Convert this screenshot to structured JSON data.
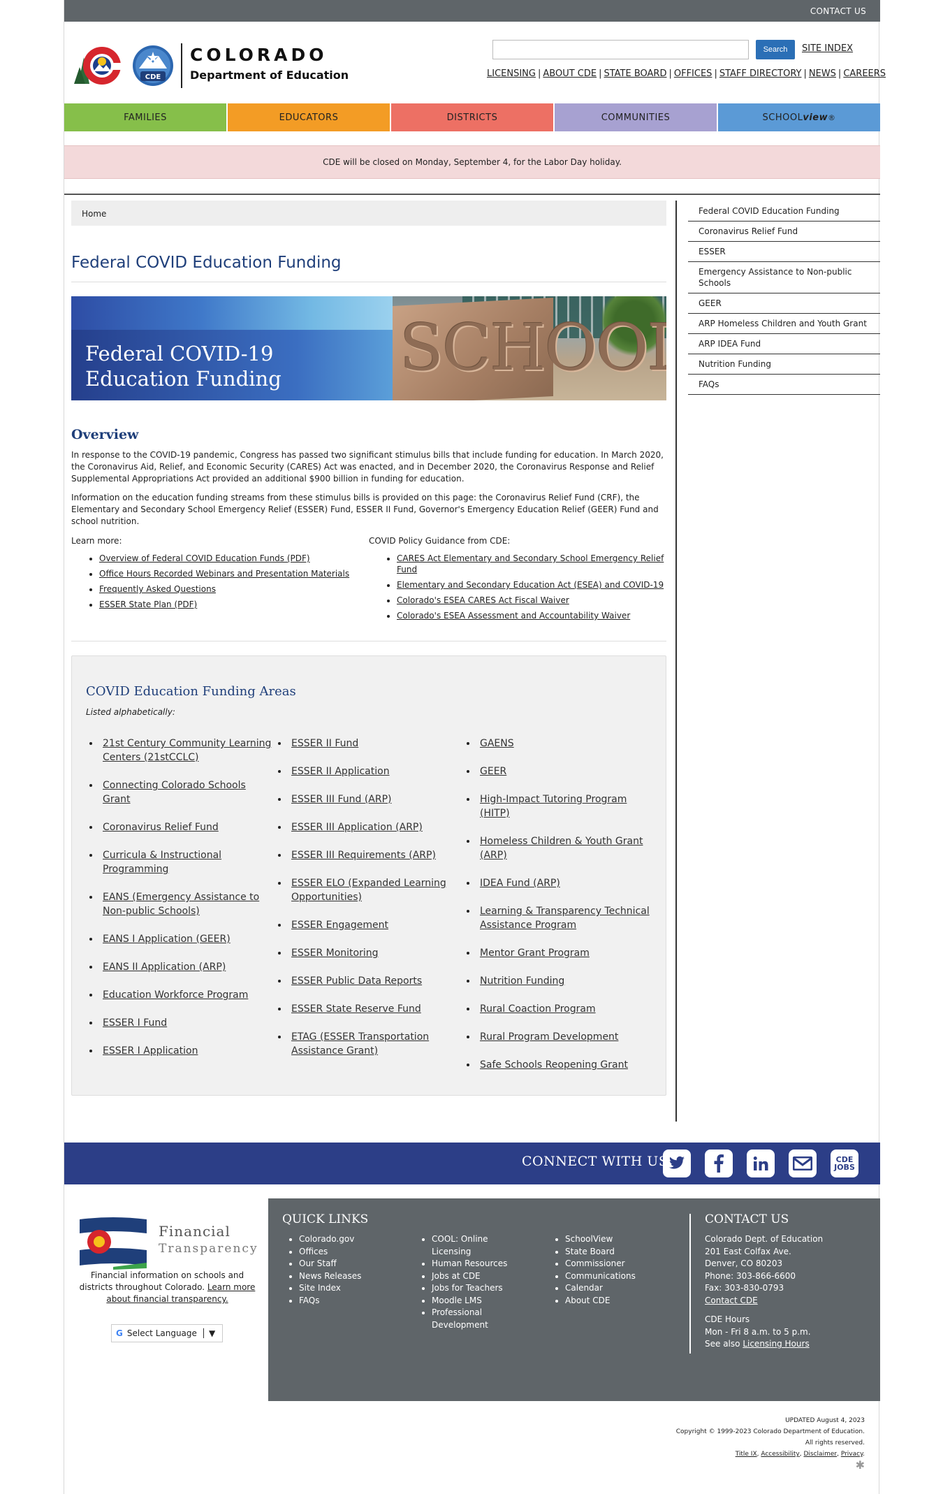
{
  "topbar": {
    "contact": "CONTACT US"
  },
  "header": {
    "logo_name": "COLORADO",
    "logo_dept": "Department of Education",
    "search_button": "Search",
    "site_index": "SITE INDEX",
    "links": [
      "LICENSING",
      "ABOUT CDE",
      "STATE BOARD",
      "OFFICES",
      "STAFF DIRECTORY",
      "NEWS",
      "CAREERS"
    ]
  },
  "nav": {
    "families": "FAMILIES",
    "educators": "EDUCATORS",
    "districts": "DISTRICTS",
    "communities": "COMMUNITIES",
    "schoolview_a": "SCHOOL",
    "schoolview_b": "view"
  },
  "alert": "CDE will be closed on Monday, September 4, for the Labor Day holiday.",
  "breadcrumb": "Home",
  "page_title": "Federal COVID Education Funding",
  "banner": {
    "line1": "Federal COVID-19",
    "line2": "Education Funding",
    "sign": "SCHOOL"
  },
  "overview": {
    "title": "Overview",
    "p1": "In response to the COVID-19 pandemic, Congress has passed two significant stimulus bills that include funding for education. In March 2020, the Coronavirus Aid, Relief, and Economic Security (CARES) Act was enacted, and in December 2020, the Coronavirus Response and Relief Supplemental Appropriations Act provided an additional $900 billion in funding for education.",
    "p2": "Information on the education funding streams from these stimulus bills is provided on this page: the Coronavirus Relief Fund (CRF), the Elementary and Secondary School Emergency Relief (ESSER) Fund, ESSER II Fund, Governor's Emergency Education Relief (GEER) Fund and school nutrition.",
    "learn_label": "Learn more:",
    "learn_links": [
      "Overview of Federal COVID Education Funds (PDF)",
      "Office Hours Recorded Webinars and Presentation Materials",
      "Frequently Asked Questions",
      "ESSER State Plan (PDF)"
    ],
    "policy_label": "COVID Policy Guidance from CDE:",
    "policy_links": [
      "CARES Act Elementary and Secondary School Emergency Relief Fund",
      "Elementary and Secondary Education Act (ESEA) and COVID-19",
      "Colorado's ESEA CARES Act Fiscal Waiver",
      "Colorado's ESEA Assessment and Accountability Waiver"
    ]
  },
  "funding": {
    "title": "COVID Education Funding Areas",
    "subtitle": "Listed alphabetically:",
    "col1": [
      "21st Century Community Learning Centers (21stCCLC)",
      "Connecting Colorado Schools Grant",
      "Coronavirus Relief Fund",
      "Curricula & Instructional Programming",
      "EANS (Emergency Assistance to Non-public Schools)",
      "EANS I Application (GEER)",
      "EANS II Application (ARP)",
      "Education Workforce Program",
      "ESSER I Fund",
      "ESSER I Application"
    ],
    "col2": [
      "ESSER II Fund",
      "ESSER II Application",
      "ESSER III Fund (ARP)",
      "ESSER III Application (ARP)",
      "ESSER III Requirements (ARP)",
      "ESSER ELO (Expanded Learning Opportunities)",
      "ESSER Engagement",
      "ESSER Monitoring",
      "ESSER Public Data Reports",
      "ESSER State Reserve Fund",
      "ETAG (ESSER Transportation Assistance Grant)"
    ],
    "col3": [
      "GAENS",
      "GEER",
      "High-Impact Tutoring Program (HITP)",
      "Homeless Children & Youth Grant (ARP)",
      "IDEA Fund (ARP)",
      "Learning & Transparency Technical Assistance Program",
      "Mentor Grant Program",
      "Nutrition Funding",
      "Rural Coaction Program",
      "Rural Program Development",
      "Safe Schools Reopening Grant"
    ]
  },
  "sidebar": [
    "Federal COVID Education Funding",
    "Coronavirus Relief Fund",
    "ESSER",
    "Emergency Assistance to Non-public Schools",
    "GEER",
    "ARP Homeless Children and Youth Grant",
    "ARP IDEA Fund",
    "Nutrition Funding",
    "FAQs"
  ],
  "connect": {
    "label": "CONNECT WITH US",
    "jobs_a": "CDE",
    "jobs_b": "JOBS"
  },
  "footer": {
    "ft_name": "Financial",
    "ft_sub": "Transparency",
    "ft_desc": "Financial information on schools and districts throughout Colorado.",
    "ft_learn": "Learn more about financial transparency.",
    "language": "Select Language",
    "quick_title": "QUICK LINKS",
    "quick1": [
      "Colorado.gov",
      "Offices",
      "Our Staff",
      "News Releases",
      "Site Index",
      "FAQs"
    ],
    "quick2": [
      "COOL: Online Licensing",
      "Human Resources",
      "Jobs at CDE",
      "Jobs for Teachers",
      "Moodle LMS",
      "Professional Development"
    ],
    "quick3": [
      "SchoolView",
      "State Board",
      "Commissioner",
      "Communications",
      "Calendar",
      "About CDE"
    ],
    "contact_title": "CONTACT US",
    "contact": [
      "Colorado Dept. of Education",
      "201 East Colfax Ave.",
      "Denver, CO 80203",
      "Phone: 303-866-6600",
      "Fax: 303-830-0793"
    ],
    "contact_link": "Contact CDE",
    "hours_title": "CDE Hours",
    "hours": "Mon - Fri 8 a.m. to 5 p.m.",
    "see_also": "See also",
    "licensing_hours": "Licensing Hours"
  },
  "bottom": {
    "updated": "UPDATED August 4, 2023",
    "copyright": "Copyright © 1999-2023 Colorado Department of Education.",
    "rights": "All rights reserved.",
    "links": [
      "Title IX",
      "Accessibility",
      "Disclaimer",
      "Privacy"
    ]
  },
  "colors": {
    "brand_blue": "#1f3f7a",
    "connect_bar": "#2c3e87",
    "footer_gray": "#5f6569",
    "search_blue": "#2b6fb6"
  }
}
